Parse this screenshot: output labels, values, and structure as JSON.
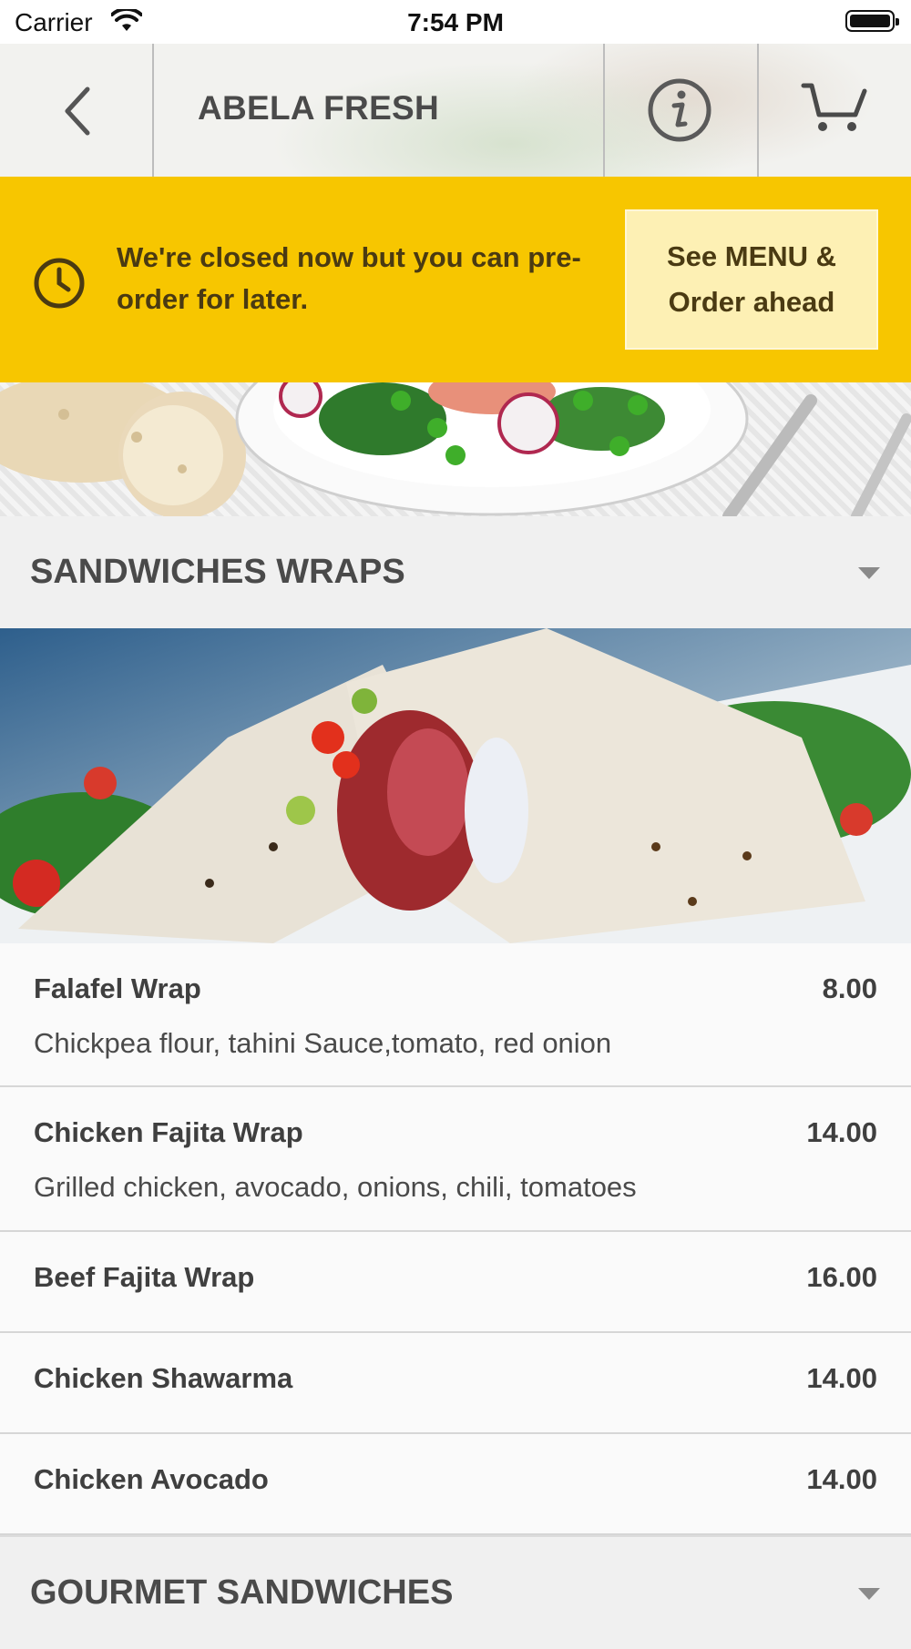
{
  "status_bar": {
    "carrier": "Carrier",
    "time": "7:54 PM"
  },
  "nav": {
    "title": "ABELA FRESH"
  },
  "banner": {
    "message": "We're closed now but you can pre-order for later.",
    "button_line1": "See MENU &",
    "button_line2": "Order ahead"
  },
  "categories": [
    {
      "title": "SANDWICHES WRAPS"
    },
    {
      "title": "GOURMET SANDWICHES"
    }
  ],
  "menu_items": [
    {
      "name": "Falafel Wrap",
      "price": "8.00",
      "description": "Chickpea flour, tahini Sauce,tomato, red onion"
    },
    {
      "name": "Chicken Fajita Wrap",
      "price": "14.00",
      "description": "Grilled chicken, avocado, onions, chili, tomatoes"
    },
    {
      "name": "Beef Fajita Wrap",
      "price": "16.00",
      "description": ""
    },
    {
      "name": "Chicken Shawarma",
      "price": "14.00",
      "description": ""
    },
    {
      "name": "Chicken Avocado",
      "price": "14.00",
      "description": ""
    }
  ],
  "colors": {
    "banner": "#f7c600",
    "banner_button": "#fdf0b4",
    "banner_text": "#4a3a12"
  },
  "icons": [
    "wifi-icon",
    "battery-icon",
    "back-chevron-icon",
    "info-icon",
    "cart-icon",
    "clock-icon",
    "chevron-down-icon"
  ]
}
